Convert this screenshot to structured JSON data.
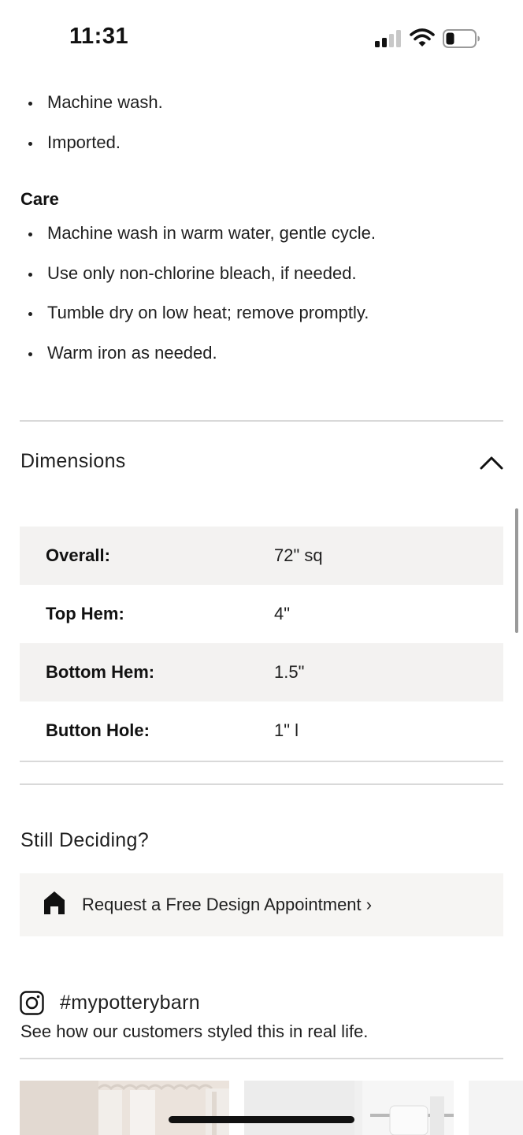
{
  "status_bar": {
    "time": "11:31"
  },
  "features": {
    "items": [
      "Machine wash.",
      "Imported."
    ]
  },
  "care": {
    "heading": "Care",
    "items": [
      "Machine wash in warm water, gentle cycle.",
      "Use only non-chlorine bleach, if needed.",
      "Tumble dry on low heat; remove promptly.",
      "Warm iron as needed."
    ]
  },
  "dimensions": {
    "title": "Dimensions",
    "rows": [
      {
        "label": "Overall:",
        "value": "72\" sq"
      },
      {
        "label": "Top Hem:",
        "value": "4\""
      },
      {
        "label": "Bottom Hem:",
        "value": "1.5\""
      },
      {
        "label": "Button Hole:",
        "value": "1\" l"
      }
    ]
  },
  "still_deciding": {
    "title": "Still Deciding?",
    "appointment_link": "Request a Free Design Appointment ›"
  },
  "instagram": {
    "hashtag": "#mypotterybarn",
    "subtitle": "See how our customers styled this in real life."
  },
  "icons": {
    "signal": "signal-icon",
    "wifi": "wifi-icon",
    "battery": "battery-icon",
    "chevron": "chevron-up-icon",
    "house": "house-icon",
    "instagram": "instagram-icon"
  }
}
